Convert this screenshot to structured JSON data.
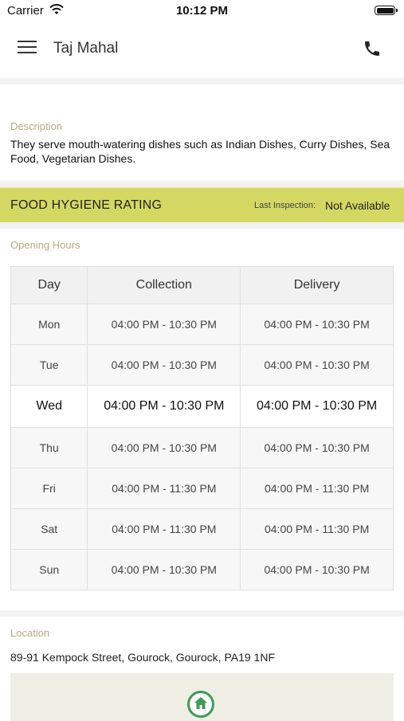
{
  "status_bar": {
    "carrier": "Carrier",
    "time": "10:12 PM"
  },
  "nav": {
    "title": "Taj Mahal",
    "menu_icon": "hamburger-menu-icon",
    "call_icon": "phone-icon"
  },
  "description": {
    "label": "Description",
    "text": "They serve mouth-watering dishes such as Indian Dishes, Curry Dishes, Sea Food, Vegetarian Dishes."
  },
  "hygiene": {
    "title": "FOOD HYGIENE RATING",
    "last_inspection_label": "Last Inspection:",
    "last_inspection_value": "Not Available",
    "bg_color": "#d4d863"
  },
  "opening_hours": {
    "label": "Opening Hours",
    "headers": [
      "Day",
      "Collection",
      "Delivery"
    ],
    "rows": [
      {
        "day": "Mon",
        "collection": "04:00 PM - 10:30 PM",
        "delivery": "04:00 PM - 10:30 PM"
      },
      {
        "day": "Tue",
        "collection": "04:00 PM - 10:30 PM",
        "delivery": "04:00 PM - 10:30 PM"
      },
      {
        "day": "Wed",
        "collection": "04:00 PM - 10:30 PM",
        "delivery": "04:00 PM - 10:30 PM"
      },
      {
        "day": "Thu",
        "collection": "04:00 PM - 10:30 PM",
        "delivery": "04:00 PM - 10:30 PM"
      },
      {
        "day": "Fri",
        "collection": "04:00 PM - 11:30 PM",
        "delivery": "04:00 PM - 11:30 PM"
      },
      {
        "day": "Sat",
        "collection": "04:00 PM - 11:30 PM",
        "delivery": "04:00 PM - 11:30 PM"
      },
      {
        "day": "Sun",
        "collection": "04:00 PM - 10:30 PM",
        "delivery": "04:00 PM - 10:30 PM"
      }
    ]
  },
  "location": {
    "label": "Location",
    "address": "89-91 Kempock Street, Gourock, Gourock, PA19 1NF",
    "map_pin_icon": "home-pin-icon"
  }
}
